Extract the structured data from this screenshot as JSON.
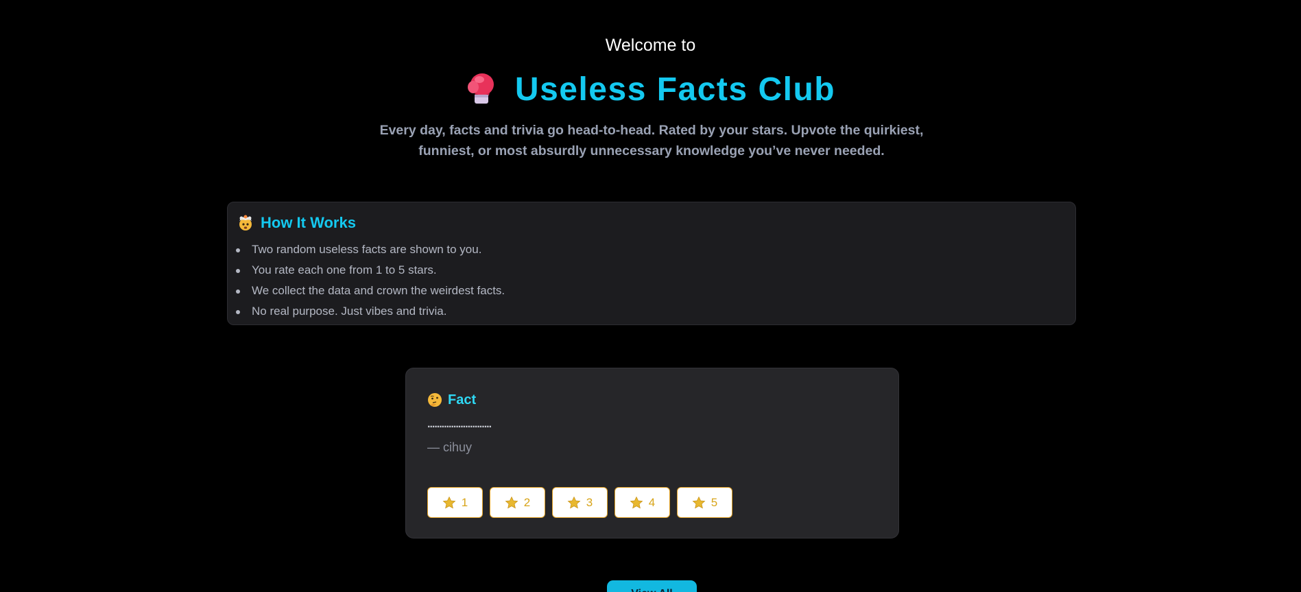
{
  "header": {
    "welcome": "Welcome to",
    "title": "Useless Facts Club",
    "title_icon": "boxing-glove-icon",
    "subtitle": "Every day, facts and trivia go head-to-head. Rated by your stars. Upvote the quirkiest, funniest, or most absurdly unnecessary knowledge you’ve never needed."
  },
  "how_it_works": {
    "icon": "exploding-head-icon",
    "title": "How It Works",
    "items": [
      "Two random useless facts are shown to you.",
      "You rate each one from 1 to 5 stars.",
      "We collect the data and crown the weirdest facts.",
      "No real purpose. Just vibes and trivia."
    ]
  },
  "fact_card": {
    "icon": "thinking-face-icon",
    "label": "Fact",
    "text": "...........................",
    "author": "— cihuy",
    "rating_buttons": [
      "1",
      "2",
      "3",
      "4",
      "5"
    ],
    "rating_icon": "star-icon"
  },
  "footer": {
    "view_button": "View All"
  },
  "colors": {
    "background": "#000000",
    "accent": "#14c9f0",
    "card": "#1c1c1f",
    "fact_card": "#262629",
    "star": "#e8b830"
  }
}
